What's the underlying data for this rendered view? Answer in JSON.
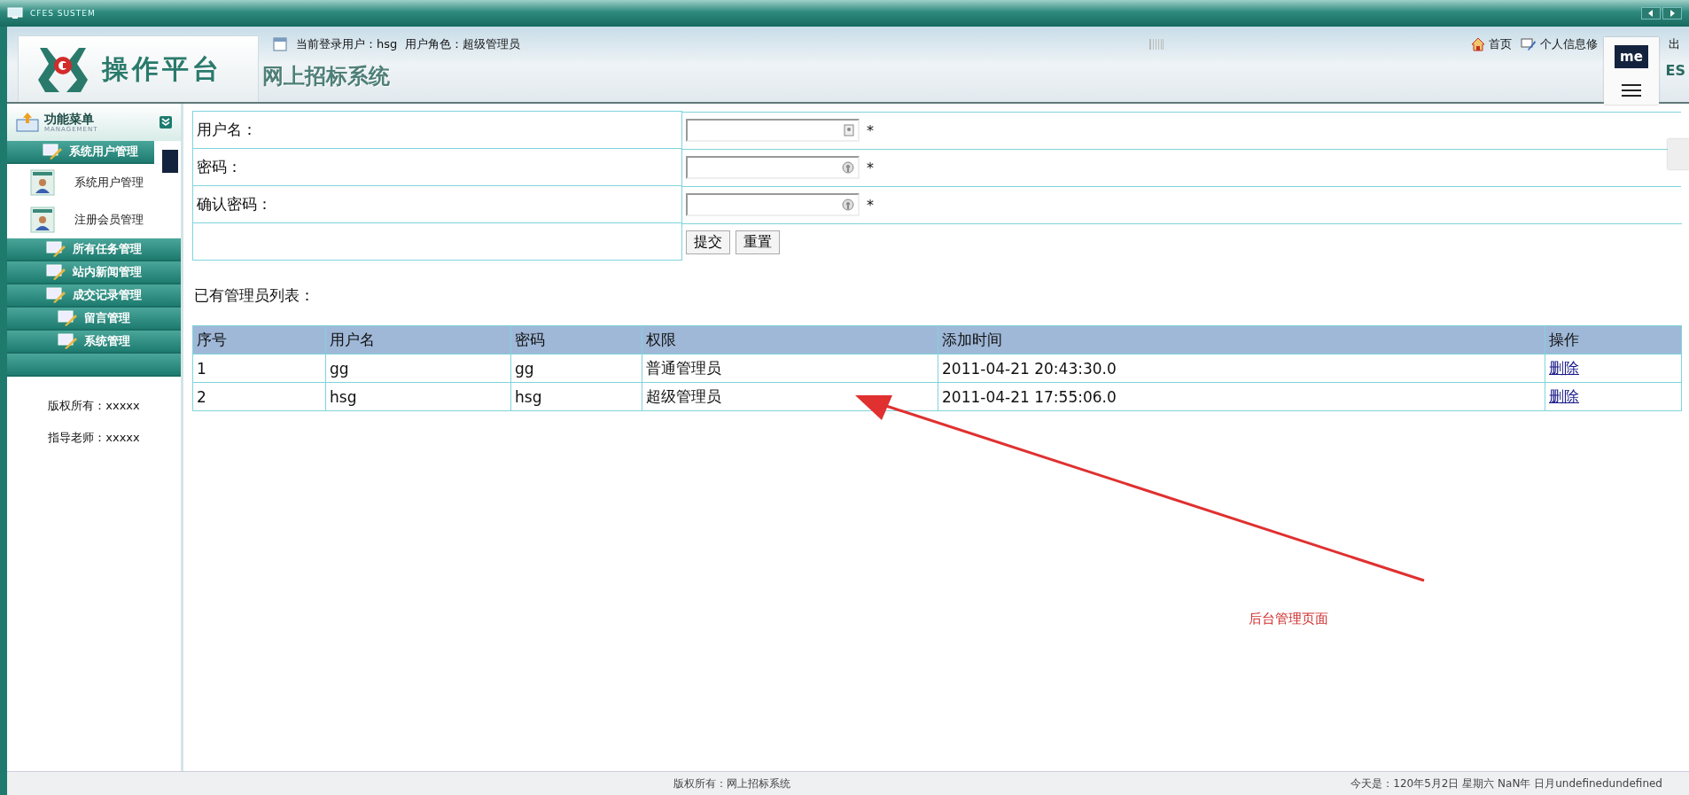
{
  "window": {
    "title": "CFES SUSTEM"
  },
  "header": {
    "logo_text": "操作平台",
    "system_name": "网上招标系统",
    "user_info": "当前登录用户：hsg  用户角色：超级管理员",
    "links": [
      {
        "label": "首页",
        "kind": "home"
      },
      {
        "label": "个人信息修",
        "kind": "edit"
      },
      {
        "label": "出",
        "kind": "plain"
      }
    ],
    "corner_text": "ES",
    "overlay_badge": "me"
  },
  "sidebar": {
    "title": "功能菜单",
    "subtitle": "MANAGEMENT",
    "groups": [
      {
        "label": "系统用户管理",
        "expanded": true,
        "children": [
          {
            "label": "系统用户管理"
          },
          {
            "label": "注册会员管理"
          }
        ]
      },
      {
        "label": "所有任务管理",
        "expanded": false
      },
      {
        "label": "站内新闻管理",
        "expanded": false
      },
      {
        "label": "成交记录管理",
        "expanded": false
      },
      {
        "label": "留言管理",
        "expanded": false
      },
      {
        "label": "系统管理",
        "expanded": false
      }
    ],
    "credits": [
      "版权所有：xxxxx",
      "指导老师：xxxxx"
    ]
  },
  "form": {
    "fields": [
      {
        "label": "用户名：",
        "kind": "text",
        "required_mark": "*"
      },
      {
        "label": "密码：",
        "kind": "password",
        "required_mark": "*"
      },
      {
        "label": "确认密码：",
        "kind": "password",
        "required_mark": "*"
      }
    ],
    "buttons": [
      "提交",
      "重置"
    ]
  },
  "list_title": "已有管理员列表：",
  "table": {
    "columns": [
      "序号",
      "用户名",
      "密码",
      "权限",
      "添加时间",
      "操作"
    ],
    "rows": [
      {
        "cells": [
          "1",
          "gg",
          "gg",
          "普通管理员",
          "2011-04-21 20:43:30.0"
        ],
        "action": "删除"
      },
      {
        "cells": [
          "2",
          "hsg",
          "hsg",
          "超级管理员",
          "2011-04-21 17:55:06.0"
        ],
        "action": "删除"
      }
    ]
  },
  "annotation": {
    "text": "后台管理页面"
  },
  "status_bar": {
    "copyright": "版权所有：网上招标系统",
    "date": "今天是：120年5月2日 星期六 NaN年 日月undefinedundefined"
  }
}
